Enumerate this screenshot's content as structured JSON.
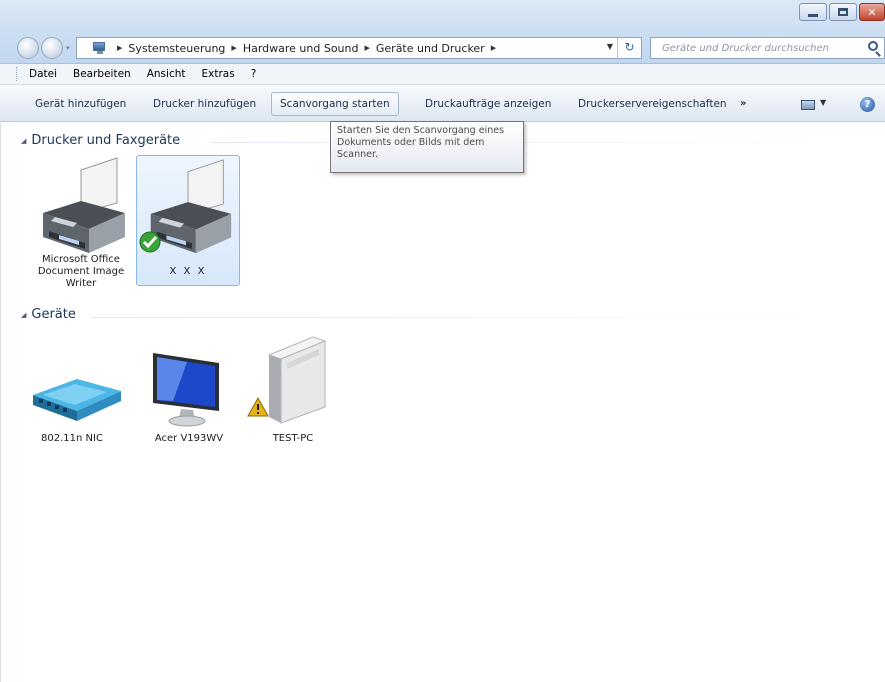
{
  "window": {
    "breadcrumb": [
      "Systemsteuerung",
      "Hardware und Sound",
      "Geräte und Drucker"
    ],
    "search_placeholder": "Geräte und Drucker durchsuchen"
  },
  "menubar": {
    "items": [
      "Datei",
      "Bearbeiten",
      "Ansicht",
      "Extras",
      "?"
    ]
  },
  "commandbar": {
    "items": [
      "Gerät hinzufügen",
      "Drucker hinzufügen",
      "Scanvorgang starten",
      "Druckaufträge anzeigen",
      "Druckerservereigenschaften"
    ],
    "more": "»"
  },
  "tooltip": {
    "text": "Starten Sie den Scanvorgang eines Dokuments oder Bilds mit dem Scanner."
  },
  "groups": {
    "printers": {
      "title": "Drucker und Faxgeräte",
      "devices": [
        {
          "label": "Microsoft Office Document Image Writer",
          "icon": "printer-icon"
        },
        {
          "label": "X X X",
          "icon": "printer-icon",
          "default": true
        }
      ]
    },
    "devices": {
      "title": "Geräte",
      "devices": [
        {
          "label": "802.11n NIC",
          "icon": "network-adapter-icon"
        },
        {
          "label": "Acer V193WV",
          "icon": "monitor-icon"
        },
        {
          "label": "TEST-PC",
          "icon": "computer-tower-icon",
          "warning": true
        }
      ]
    }
  },
  "colors": {
    "accent": "#2d64a8",
    "selection_bg": "#d7e8fb",
    "selection_border": "#8ab6e8",
    "default_check": "#3aa33a",
    "warning": "#e8b21a"
  }
}
